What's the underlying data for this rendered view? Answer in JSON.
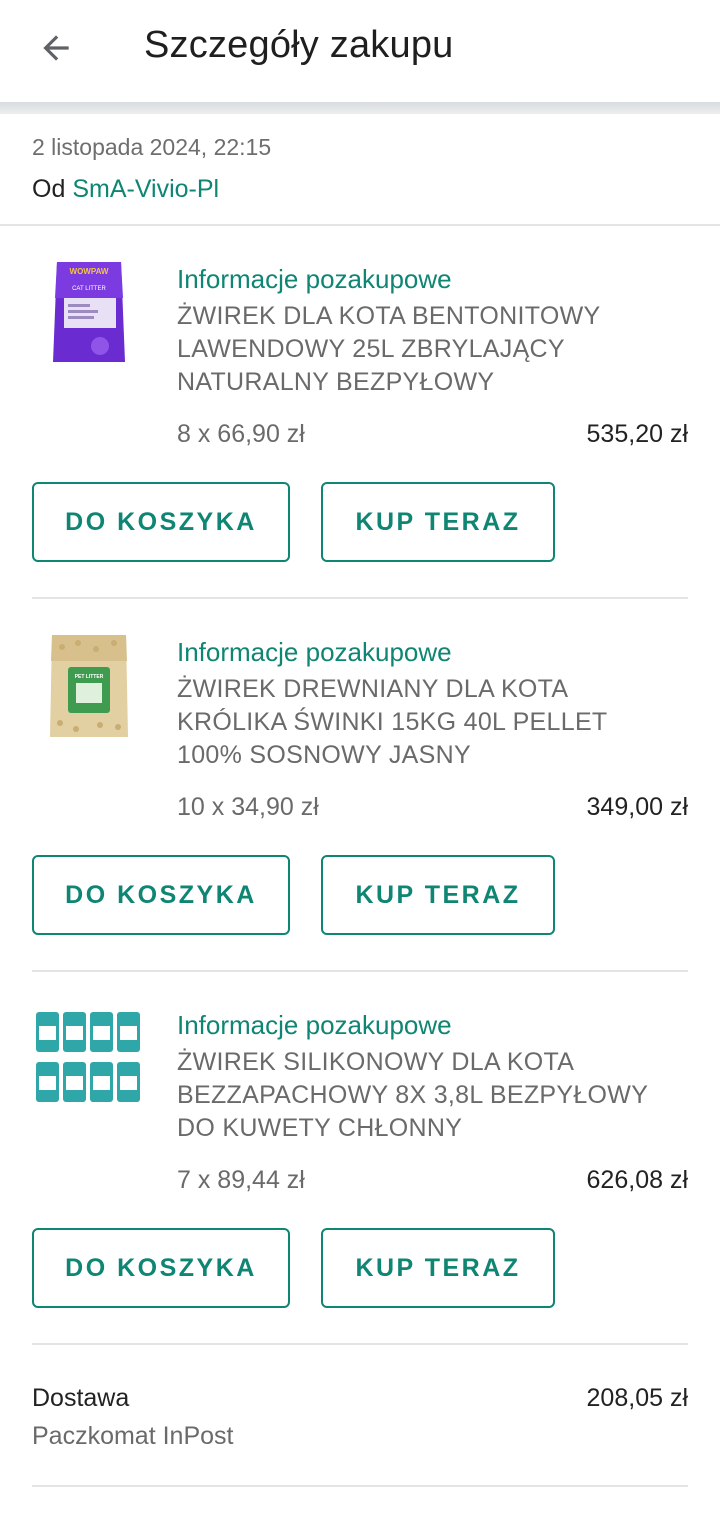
{
  "header": {
    "title": "Szczegóły zakupu",
    "back_icon": "arrow-back-icon"
  },
  "order": {
    "date": "2 listopada 2024, 22:15",
    "from_label": "Od",
    "seller": "SmA-Vivio-Pl"
  },
  "items": [
    {
      "info_link": "Informacje pozakupowe",
      "name": "ŻWIREK DLA KOTA BENTONITOWY LAWENDOWY 25L ZBRYLAJĄCY NATURALNY BEZPYŁOWY",
      "quantity_price": "8 x 66,90 zł",
      "total": "535,20 zł",
      "cart_label": "DO KOSZYKA",
      "buy_label": "KUP TERAZ",
      "thumb_label": "WOWPAW",
      "thumb_sublabel": "CAT LITTER"
    },
    {
      "info_link": "Informacje pozakupowe",
      "name": "ŻWIREK DREWNIANY DLA KOTA KRÓLIKA ŚWINKI 15KG 40L PELLET 100% SOSNOWY JASNY",
      "quantity_price": "10 x 34,90 zł",
      "total": "349,00 zł",
      "cart_label": "DO KOSZYKA",
      "buy_label": "KUP TERAZ",
      "thumb_label": "PET LITTER"
    },
    {
      "info_link": "Informacje pozakupowe",
      "name": "ŻWIREK SILIKONOWY DLA KOTA BEZZAPACHOWY 8X 3,8L BEZPYŁOWY DO KUWETY CHŁONNY",
      "quantity_price": "7 x 89,44 zł",
      "total": "626,08 zł",
      "cart_label": "DO KOSZYKA",
      "buy_label": "KUP TERAZ"
    }
  ],
  "delivery": {
    "label": "Dostawa",
    "method": "Paczkomat InPost",
    "price": "208,05 zł"
  },
  "colors": {
    "accent": "#0f8573",
    "text_secondary": "#6a6a6a",
    "divider": "#e4e4e4"
  }
}
